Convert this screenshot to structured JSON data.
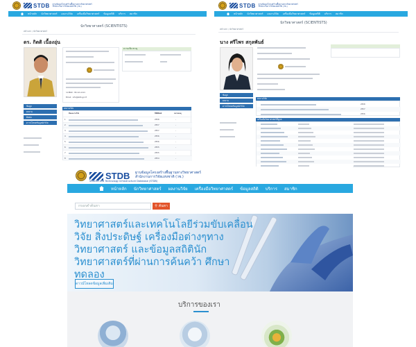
{
  "brand": {
    "name": "STDB",
    "sub_th": "ฐานข้อมูลโครงสร้างพื้นฐานทางวิทยาศาสตร์",
    "sub_th2": "สำนักงานการวิจัยแห่งชาติ (วช.)",
    "sub_en": "Science and Technology Infrastructure Database (STDB)"
  },
  "nav": {
    "items": [
      "หน้าหลัก",
      "นักวิทยาศาสตร์",
      "ผลงานวิจัย",
      "เครื่องมือวิทยาศาสตร์",
      "ข้อมูลสถิติ",
      "บริการ",
      "สมาชิก"
    ]
  },
  "profile_left": {
    "breadcrumb": "หน้าแรก / นักวิทยาศาสตร์",
    "page_title": "นักวิทยาศาสตร์ (SCIENTISTS)",
    "person_name": "ดร. กิตติ เนื้องอุ่น",
    "buttons": [
      "ข้อมูล",
      "ผลงาน",
      "ติดต่อ",
      "ดาวน์โหลดข้อมูลนักวิจัย"
    ],
    "email_label": "Email : info@stdb.go.th",
    "phone_label": "โทรศัพท์ : 02-xxx-xxxx",
    "expertise_header": "ความเชี่ยวชาญ",
    "research_header": "ผลงานวิจัย",
    "col_title": "ชื่อผลงานวิจัย",
    "col_year": "ปีที่ตีพิมพ์",
    "col_note": "หมายเหตุ",
    "years": [
      "2558",
      "2557",
      "2557",
      "2556",
      "2556",
      "2555",
      "2555",
      "2554"
    ]
  },
  "profile_right": {
    "breadcrumb": "หน้าแรก / นักวิทยาศาสตร์",
    "page_title": "นักวิทยาศาสตร์ (SCIENTISTS)",
    "person_name": "นาง ศรีไพร สกุลพันธ์",
    "buttons": [
      "ข้อมูล",
      "ผลงาน",
      "ดาวน์โหลดข้อมูลนักวิจัย"
    ],
    "research_header": "ผลงานวิจัย",
    "tools_header": "เครื่องมือวิทยาศาสตร์ที่ดูแล",
    "years": [
      "2558",
      "2557",
      "2556"
    ]
  },
  "home": {
    "search_placeholder": "กรอกคำค้นหา",
    "search_button": "ค้นหา",
    "hero_lines": [
      "วิทยาศาสตร์และเทคโนโลยีร่วมขับเคลื่อน",
      "วิจัย สิ่งประดิษฐ์ เครื่องมือต่างๆทาง",
      "วิทยาศาสตร์ และข้อมูลสถิตินัก",
      "วิทยาศาสตร์ที่ผ่านการค้นคว้า ศึกษา",
      "ทดลอง"
    ],
    "hero_button": "ดาวน์โหลดข้อมูลเพิ่มเติม",
    "services_title": "บริการของเรา"
  },
  "colors": {
    "nav_blue": "#29a8e0",
    "brand_blue": "#1b4fa0",
    "button_blue": "#2d6fb0",
    "search_orange": "#e2542b"
  }
}
